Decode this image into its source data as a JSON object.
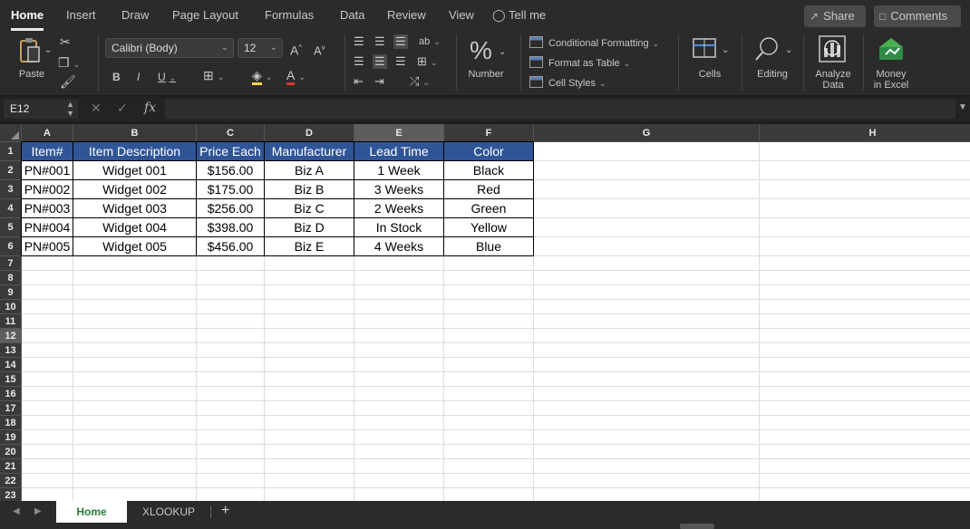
{
  "ribbon_tabs": [
    "Home",
    "Insert",
    "Draw",
    "Page Layout",
    "Formulas",
    "Data",
    "Review",
    "View",
    "Tell me"
  ],
  "active_tab": "Home",
  "share_label": "Share",
  "comments_label": "Comments",
  "clipboard": {
    "paste_label": "Paste"
  },
  "font": {
    "name": "Calibri (Body)",
    "size": "12"
  },
  "number_label": "Number",
  "styles": {
    "conditional_formatting": "Conditional Formatting",
    "format_as_table": "Format as Table",
    "cell_styles": "Cell Styles"
  },
  "cells_label": "Cells",
  "editing_label": "Editing",
  "analyze_label_1": "Analyze",
  "analyze_label_2": "Data",
  "money_label_1": "Money",
  "money_label_2": "in Excel",
  "namebox": "E12",
  "formula_value": "",
  "columns": [
    "A",
    "B",
    "C",
    "D",
    "E",
    "F",
    "G",
    "H"
  ],
  "selected_column": "E",
  "rows": [
    "1",
    "2",
    "3",
    "4",
    "5",
    "6",
    "7",
    "8",
    "9",
    "10",
    "11",
    "12",
    "13",
    "14",
    "15",
    "16",
    "17",
    "18",
    "19",
    "20",
    "21",
    "22",
    "23"
  ],
  "selected_row": "12",
  "table": {
    "headers": [
      "Item#",
      "Item Description",
      "Price Each",
      "Manufacturer",
      "Lead Time",
      "Color"
    ],
    "rows": [
      [
        "PN#001",
        "Widget 001",
        "$156.00",
        "Biz A",
        "1 Week",
        "Black"
      ],
      [
        "PN#002",
        "Widget 002",
        "$175.00",
        "Biz B",
        "3 Weeks",
        "Red"
      ],
      [
        "PN#003",
        "Widget 003",
        "$256.00",
        "Biz C",
        "2 Weeks",
        "Green"
      ],
      [
        "PN#004",
        "Widget 004",
        "$398.00",
        "Biz D",
        "In Stock",
        "Yellow"
      ],
      [
        "PN#005",
        "Widget 005",
        "$456.00",
        "Biz E",
        "4 Weeks",
        "Blue"
      ]
    ]
  },
  "sheet_tabs": [
    "Home",
    "XLOOKUP"
  ],
  "active_sheet": "Home",
  "add_sheet_label": "+",
  "colors": {
    "header_fill": "#2f5597",
    "active_sheet_text": "#2a7a3b"
  }
}
